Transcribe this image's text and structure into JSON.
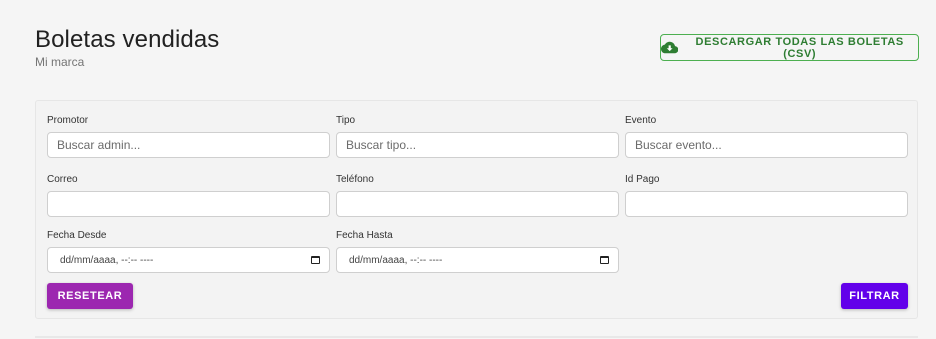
{
  "header": {
    "title": "Boletas vendidas",
    "subtitle": "Mi marca",
    "download_label": "DESCARGAR TODAS LAS BOLETAS (CSV)"
  },
  "filters": {
    "promotor": {
      "label": "Promotor",
      "placeholder": "Buscar admin..."
    },
    "tipo": {
      "label": "Tipo",
      "placeholder": "Buscar tipo..."
    },
    "evento": {
      "label": "Evento",
      "placeholder": "Buscar evento..."
    },
    "correo": {
      "label": "Correo",
      "value": ""
    },
    "telefono": {
      "label": "Teléfono",
      "value": ""
    },
    "id_pago": {
      "label": "Id Pago",
      "value": ""
    },
    "fecha_desde": {
      "label": "Fecha Desde",
      "value": "dd/mm/aaaa, --:-- ----"
    },
    "fecha_hasta": {
      "label": "Fecha Hasta",
      "value": "dd/mm/aaaa, --:-- ----"
    }
  },
  "actions": {
    "reset_label": "RESETEAR",
    "filter_label": "FILTRAR"
  },
  "colors": {
    "download_accent": "#2e7d32",
    "reset_button": "#9c27b0",
    "filter_button": "#6200ea"
  },
  "icons": {
    "download": "cloud-download-icon",
    "calendar": "calendar-icon"
  }
}
